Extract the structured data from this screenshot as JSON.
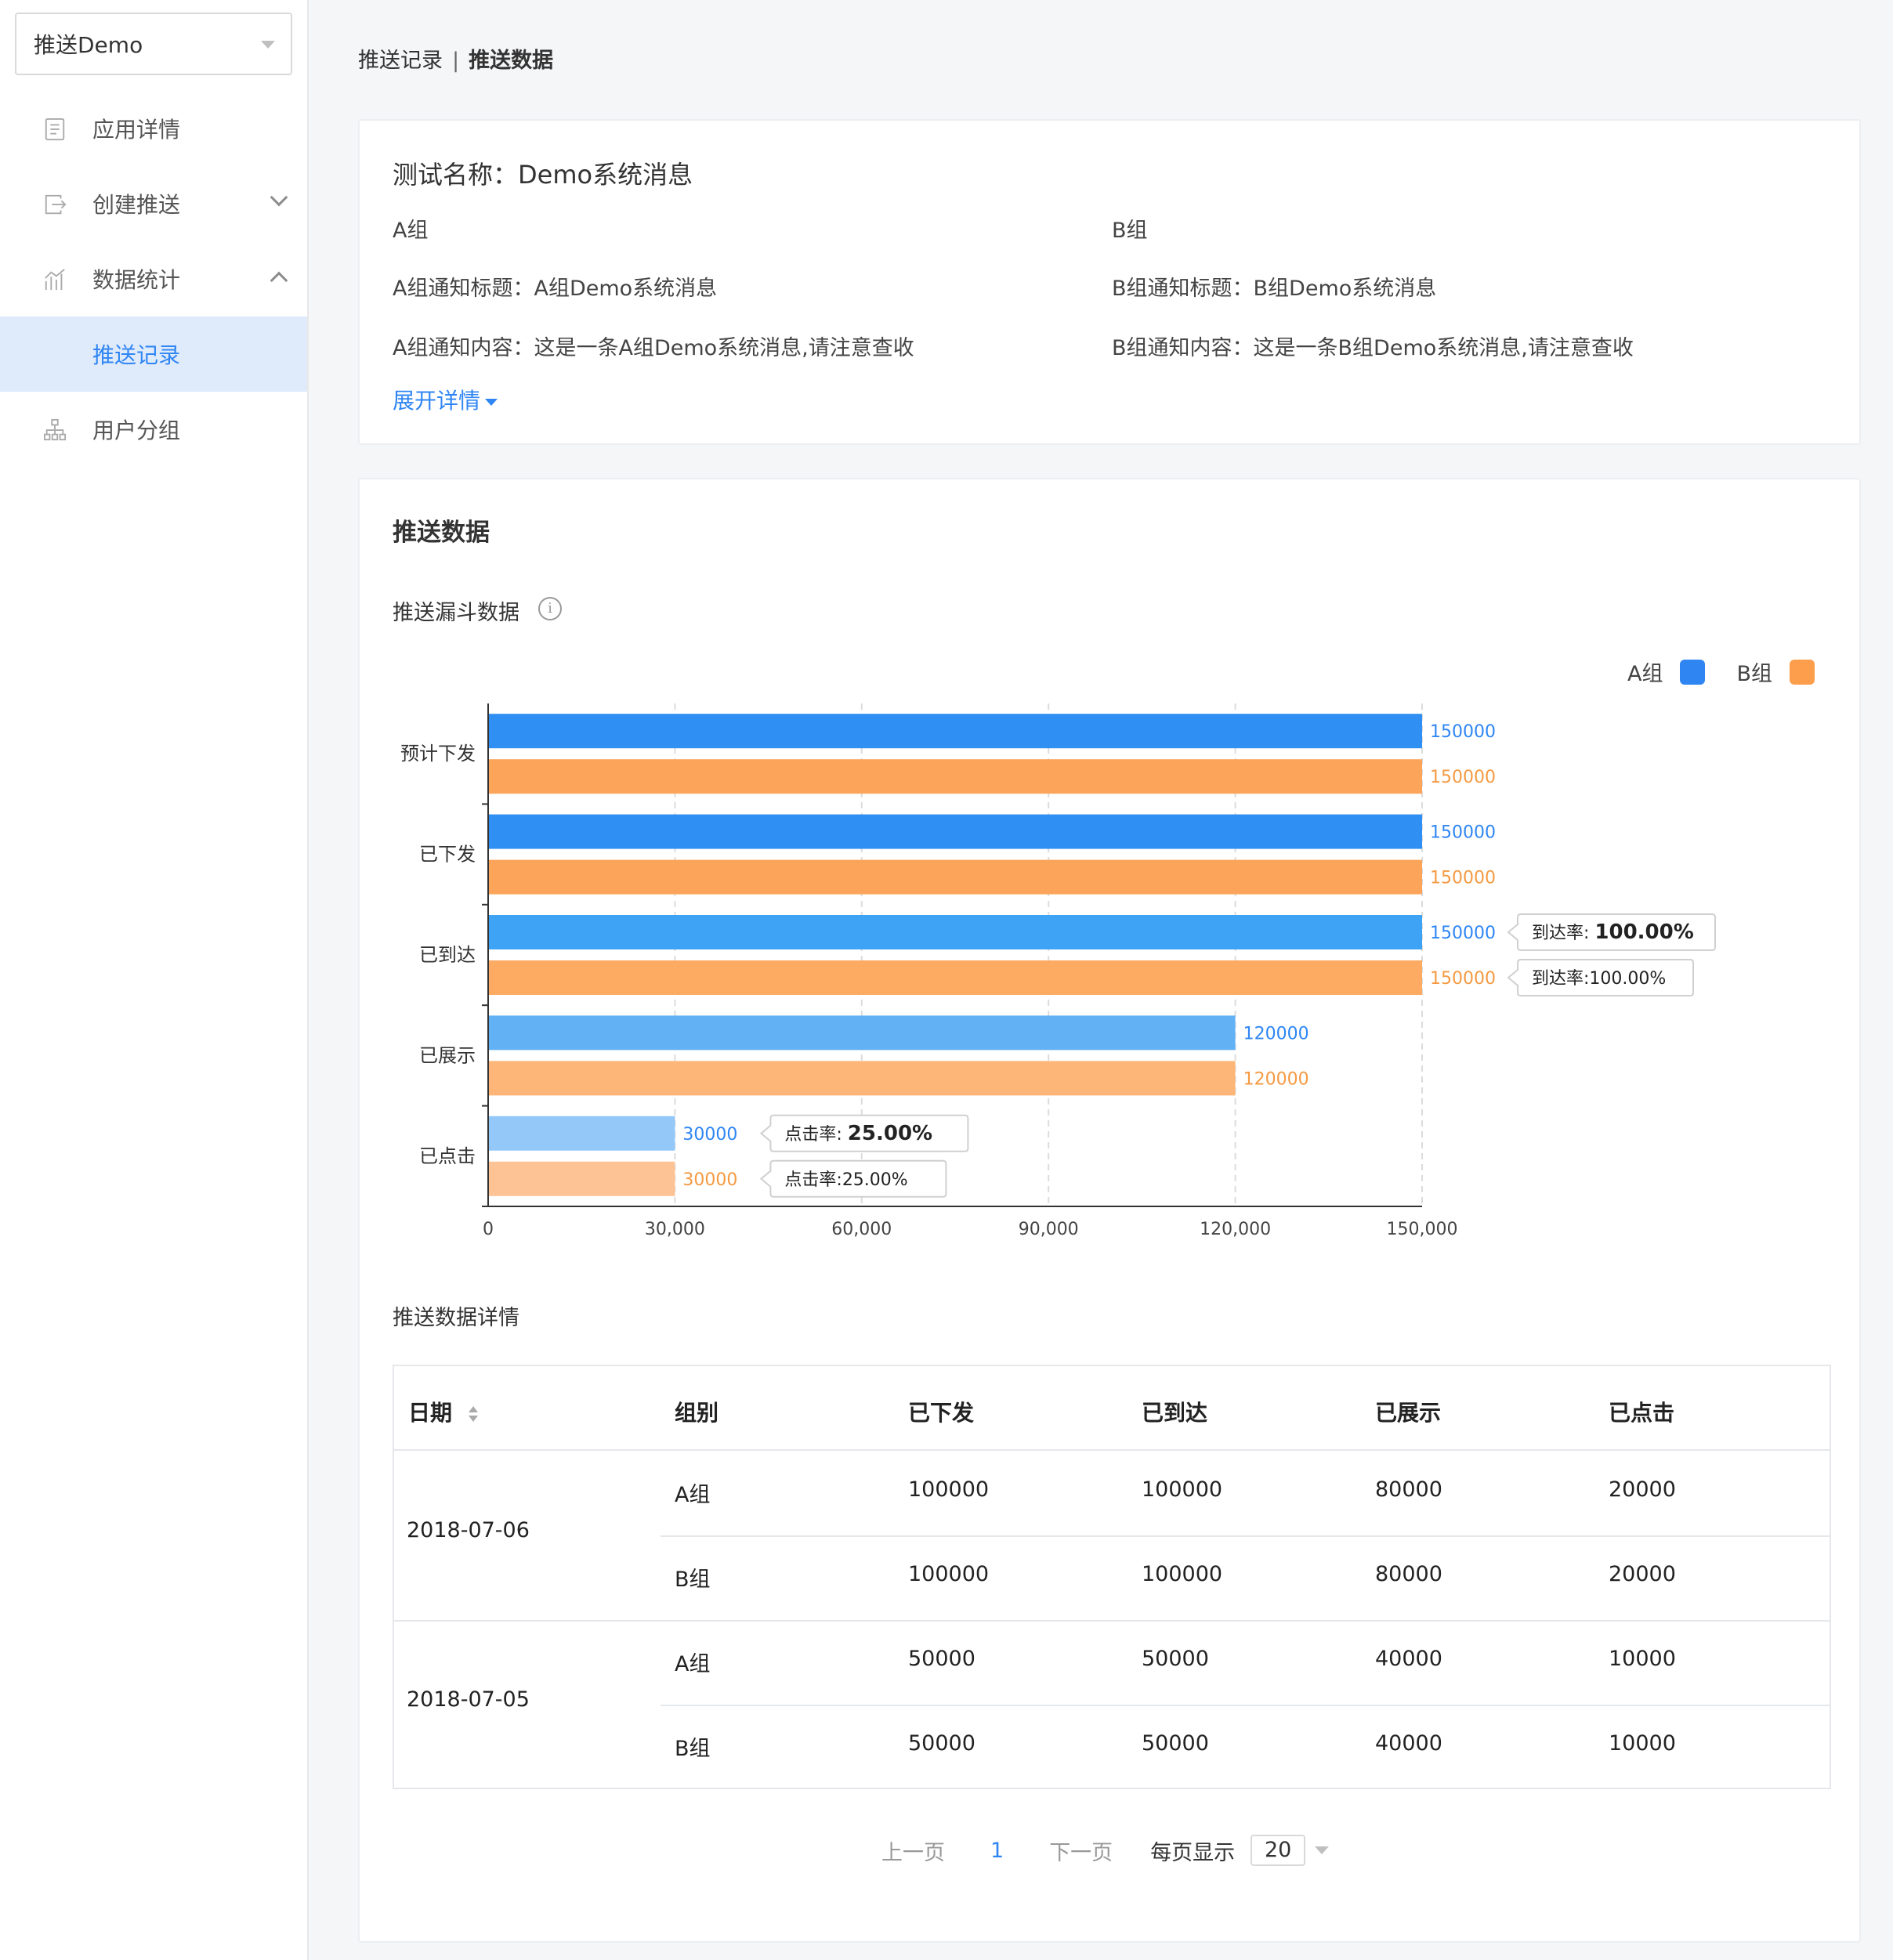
{
  "sidebar": {
    "app_select": "推送Demo",
    "items": [
      {
        "label": "应用详情",
        "icon": "document-icon"
      },
      {
        "label": "创建推送",
        "icon": "export-icon"
      },
      {
        "label": "数据统计",
        "icon": "bar-chart-icon"
      },
      {
        "label": "推送记录",
        "active": true
      },
      {
        "label": "用户分组",
        "icon": "org-chart-icon"
      }
    ]
  },
  "breadcrumb": {
    "parent": "推送记录",
    "separator": "|",
    "current": "推送数据"
  },
  "test_info": {
    "name": "测试名称：Demo系统消息",
    "group_a": {
      "title": "A组",
      "notify_title": "A组通知标题：A组Demo系统消息",
      "notify_content": "A组通知内容：这是一条A组Demo系统消息,请注意查收"
    },
    "group_b": {
      "title": "B组",
      "notify_title": "B组通知标题：B组Demo系统消息",
      "notify_content": "B组通知内容：这是一条B组Demo系统消息,请注意查收"
    },
    "expand_label": "展开详情"
  },
  "push_data": {
    "section_title": "推送数据",
    "funnel_title": "推送漏斗数据",
    "info_icon": "info-icon",
    "legend": [
      {
        "label": "A组",
        "color": "#2f86f3"
      },
      {
        "label": "B组",
        "color": "#fd9e4d"
      }
    ]
  },
  "chart_data": {
    "type": "bar",
    "orientation": "horizontal",
    "categories": [
      "预计下发",
      "已下发",
      "已到达",
      "已展示",
      "已点击"
    ],
    "series": [
      {
        "name": "A组",
        "values": [
          150000,
          150000,
          150000,
          120000,
          30000
        ],
        "colors": [
          "#2f8ff2",
          "#2f8ff2",
          "#3ea3f5",
          "#62b1f5",
          "#93c8f8"
        ],
        "label_color": "#2f86f3"
      },
      {
        "name": "B组",
        "values": [
          150000,
          150000,
          150000,
          120000,
          30000
        ],
        "colors": [
          "#fca55a",
          "#fca55a",
          "#fdaa63",
          "#fdb677",
          "#fdc394"
        ],
        "label_color": "#f59a43"
      }
    ],
    "xticks": [
      "0",
      "30,000",
      "60,000",
      "90,000",
      "120,000",
      "150,000"
    ],
    "xlim": [
      0,
      150000
    ],
    "grid": true,
    "legend_position": "top-right",
    "annotations": [
      {
        "category": "已到达",
        "series": "A组",
        "prefix": "到达率: ",
        "value": "100.00%",
        "bold": true
      },
      {
        "category": "已到达",
        "series": "B组",
        "prefix": "到达率:",
        "value": "100.00%",
        "bold": false
      },
      {
        "category": "已点击",
        "series": "A组",
        "prefix": "点击率: ",
        "value": "25.00%",
        "bold": true
      },
      {
        "category": "已点击",
        "series": "B组",
        "prefix": "点击率:",
        "value": "25.00%",
        "bold": false
      }
    ]
  },
  "table": {
    "title": "推送数据详情",
    "columns": [
      "日期",
      "组别",
      "已下发",
      "已到达",
      "已展示",
      "已点击"
    ],
    "date_groups": [
      {
        "date": "2018-07-06",
        "rows": [
          [
            "A组",
            "100000",
            "100000",
            "80000",
            "20000"
          ],
          [
            "B组",
            "100000",
            "100000",
            "80000",
            "20000"
          ]
        ]
      },
      {
        "date": "2018-07-05",
        "rows": [
          [
            "A组",
            "50000",
            "50000",
            "40000",
            "10000"
          ],
          [
            "B组",
            "50000",
            "50000",
            "40000",
            "10000"
          ]
        ]
      }
    ]
  },
  "pagination": {
    "prev": "上一页",
    "current": "1",
    "next": "下一页",
    "size_label": "每页显示",
    "size": "20"
  }
}
